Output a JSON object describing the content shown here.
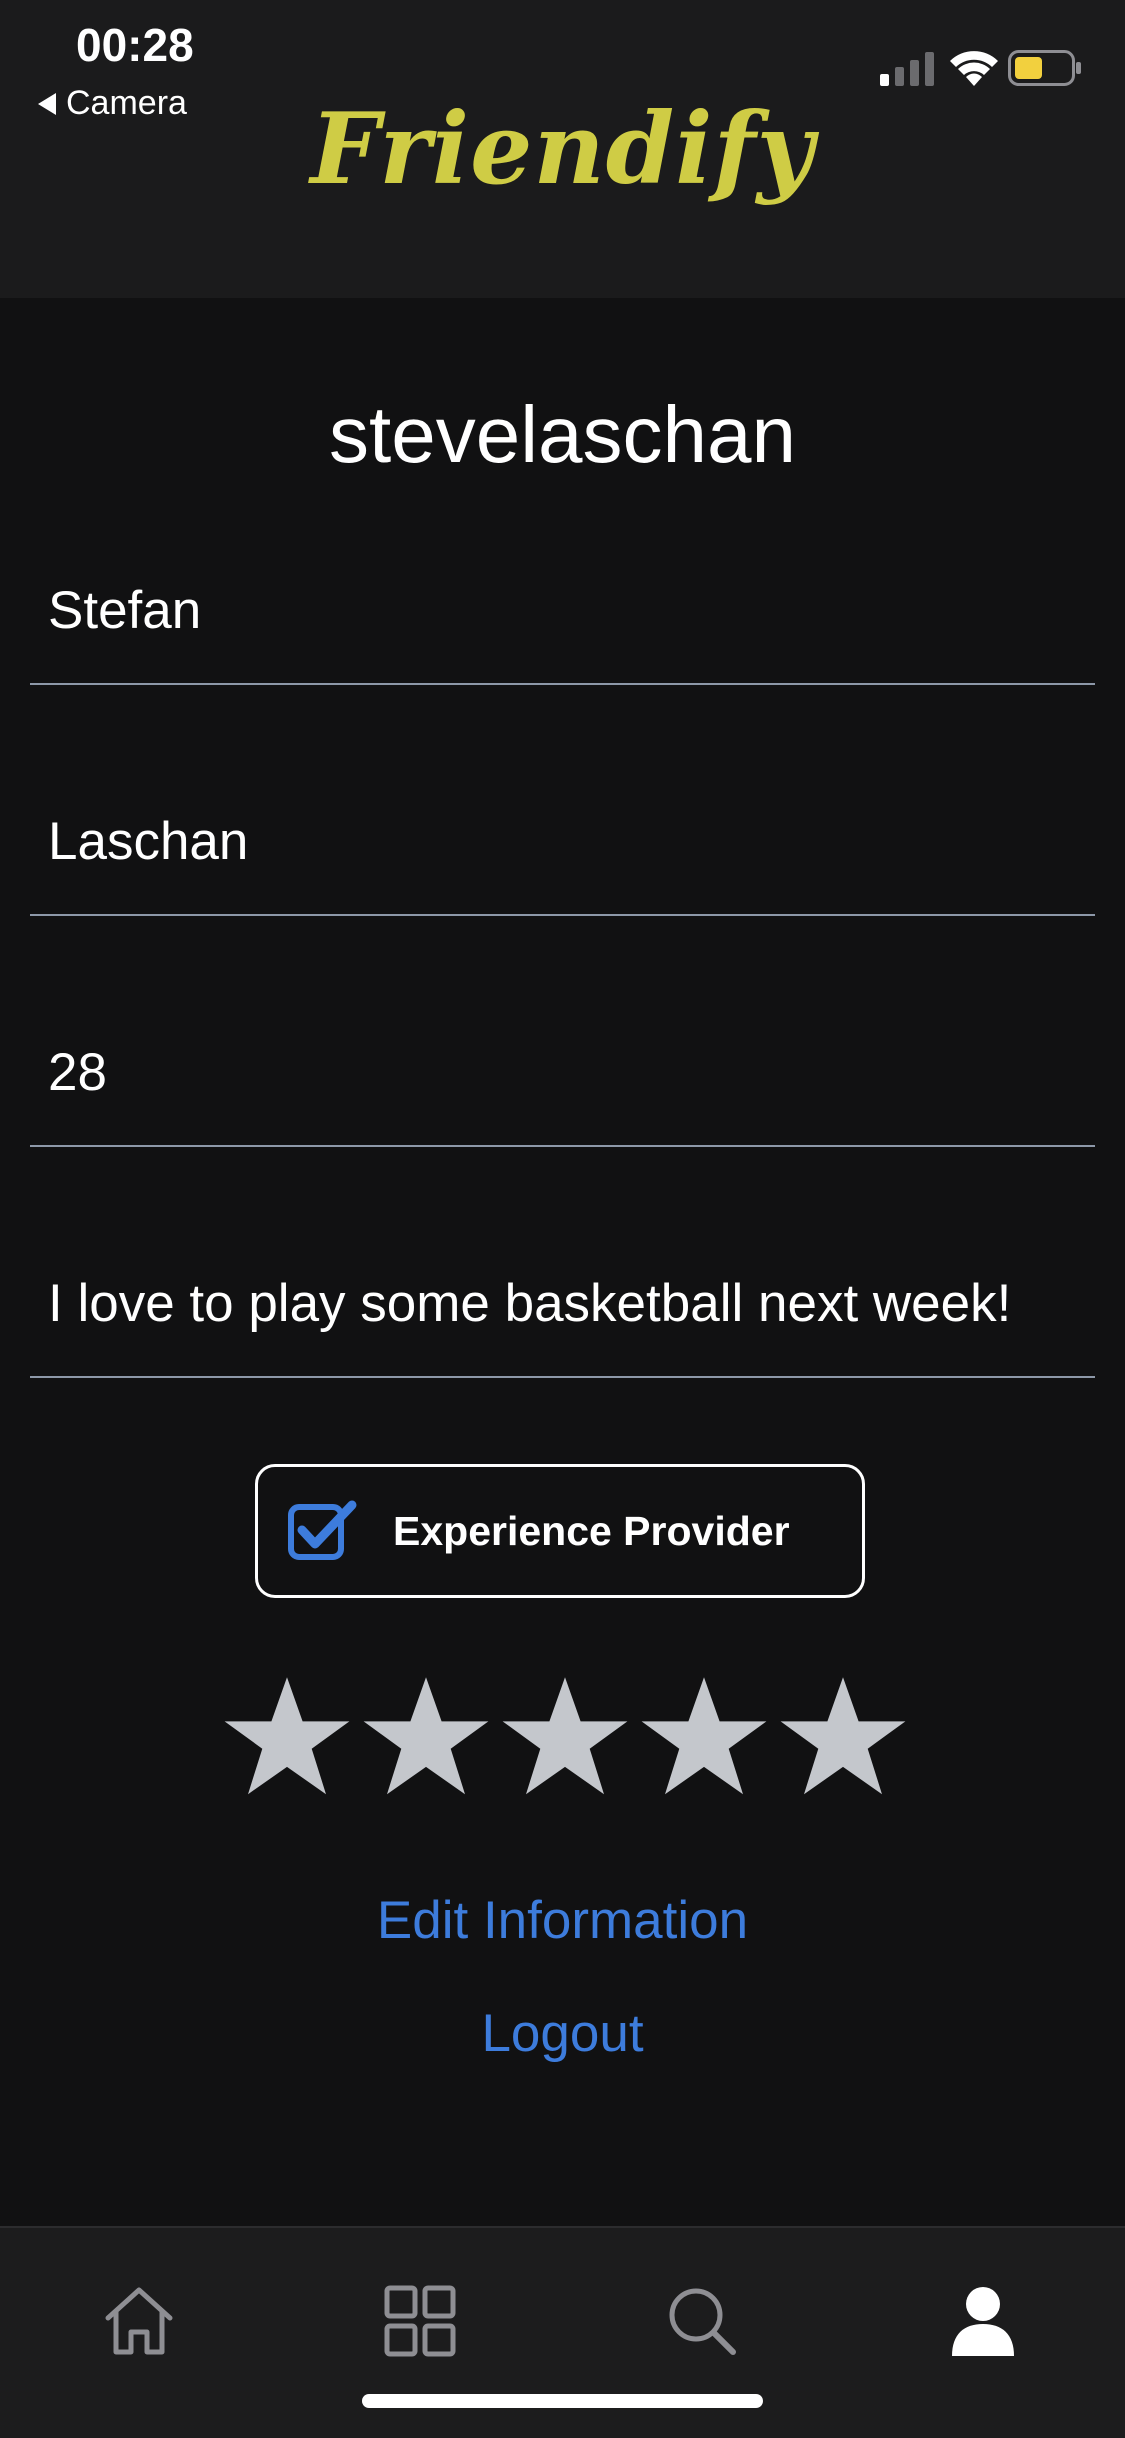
{
  "status_bar": {
    "time": "00:28",
    "back_label": "Camera",
    "battery_color": "#f2d03e"
  },
  "header": {
    "logo_text": "Friendify",
    "logo_color": "#cfcc45"
  },
  "profile": {
    "username": "stevelaschan",
    "fields": {
      "first_name": "Stefan",
      "last_name": "Laschan",
      "age": "28",
      "bio": "I love to play some basketball next week!"
    },
    "experience_provider": {
      "label": "Experience Provider",
      "checked": true,
      "check_color": "#3d7cdc"
    },
    "rating": {
      "value": 5,
      "max": 5,
      "star_color": "#c4c7cc"
    }
  },
  "actions": {
    "edit_label": "Edit Information",
    "logout_label": "Logout",
    "link_color": "#3d7cdc"
  },
  "tab_bar": {
    "tabs": [
      {
        "icon": "home-icon",
        "active": false
      },
      {
        "icon": "grid-icon",
        "active": false
      },
      {
        "icon": "search-icon",
        "active": false
      },
      {
        "icon": "person-icon",
        "active": true
      }
    ]
  }
}
